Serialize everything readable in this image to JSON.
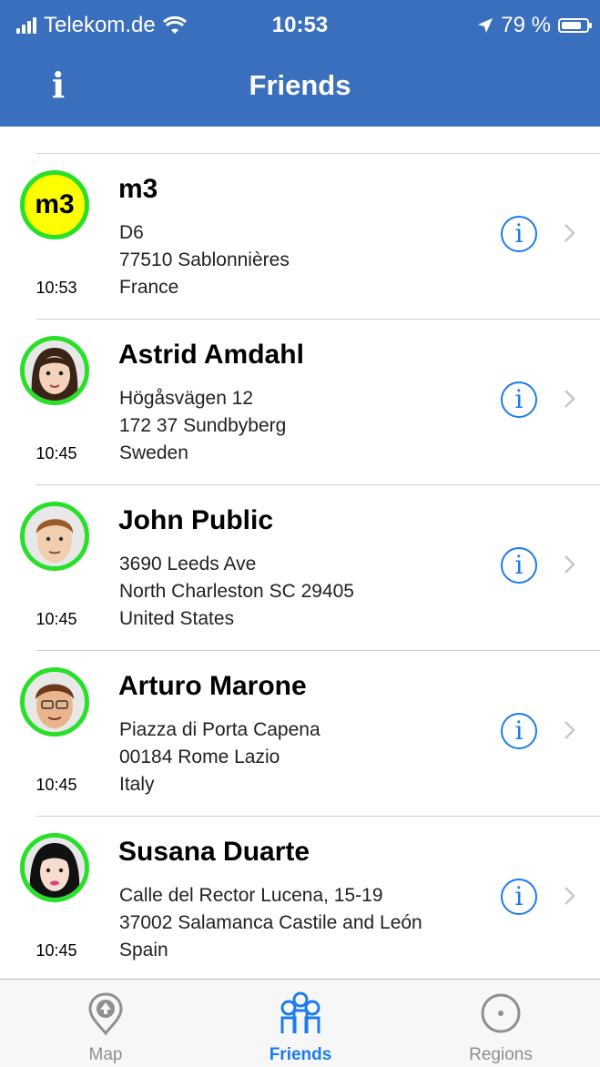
{
  "status_bar": {
    "carrier": "Telekom.de",
    "time": "10:53",
    "battery": "79 %",
    "battery_level": 0.79
  },
  "nav": {
    "title": "Friends",
    "info_icon": "info-icon"
  },
  "friends": [
    {
      "name": "m3",
      "line1": "D6",
      "line2": "77510 Sablonnières",
      "line3": "France",
      "time": "10:53",
      "avatar_text": "m3"
    },
    {
      "name": "Astrid Amdahl",
      "line1": "Högåsvägen 12",
      "line2": "172 37 Sundbyberg",
      "line3": "Sweden",
      "time": "10:45"
    },
    {
      "name": "John Public",
      "line1": "3690 Leeds Ave",
      "line2": "North Charleston SC 29405",
      "line3": "United States",
      "time": "10:45"
    },
    {
      "name": "Arturo Marone",
      "line1": "Piazza di Porta Capena",
      "line2": "00184 Rome Lazio",
      "line3": "Italy",
      "time": "10:45"
    },
    {
      "name": "Susana Duarte",
      "line1": "Calle del Rector Lucena, 15-19",
      "line2": "37002 Salamanca Castile and León",
      "line3": "Spain",
      "time": "10:45"
    }
  ],
  "tabs": [
    {
      "label": "Map",
      "icon": "map-pin-icon",
      "active": false
    },
    {
      "label": "Friends",
      "icon": "friends-icon",
      "active": true
    },
    {
      "label": "Regions",
      "icon": "regions-icon",
      "active": false
    }
  ],
  "colors": {
    "nav_bar": "#3a6fbd",
    "accent": "#1a7cf0",
    "avatar_ring": "#28e028",
    "m3_avatar_bg": "#ffff00"
  }
}
